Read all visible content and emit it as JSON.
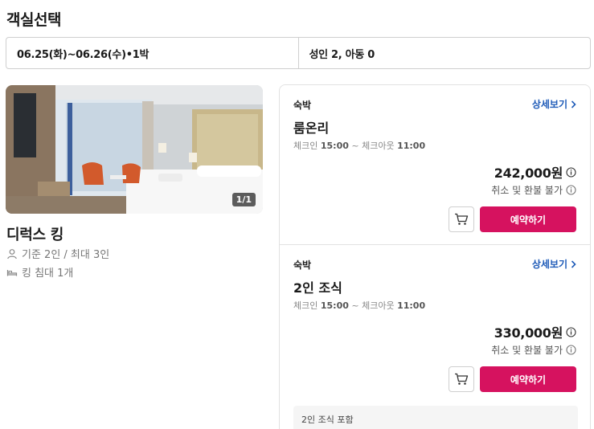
{
  "page": {
    "title": "객실선택"
  },
  "filters": {
    "dates": "06.25(화)~06.26(수)•1박",
    "guests": "성인 2, 아동 0"
  },
  "room": {
    "photo_counter": "1/1",
    "name": "디럭스 킹",
    "capacity": "기준 2인 / 최대 3인",
    "bed": "킹 침대 1개"
  },
  "offers": [
    {
      "type": "숙박",
      "detail_link": "상세보기",
      "name": "룸온리",
      "checkin_label": "체크인",
      "checkin_time": "15:00",
      "separator": "~",
      "checkout_label": "체크아웃",
      "checkout_time": "11:00",
      "price": "242,000원",
      "policy": "취소 및 환불 불가",
      "book_label": "예약하기"
    },
    {
      "type": "숙박",
      "detail_link": "상세보기",
      "name": "2인 조식",
      "checkin_label": "체크인",
      "checkin_time": "15:00",
      "separator": "~",
      "checkout_label": "체크아웃",
      "checkout_time": "11:00",
      "price": "330,000원",
      "policy": "취소 및 환불 불가",
      "book_label": "예약하기",
      "includes": "2인 조식 포함"
    }
  ],
  "colors": {
    "accent": "#d6125f",
    "link": "#1e5bb8"
  }
}
